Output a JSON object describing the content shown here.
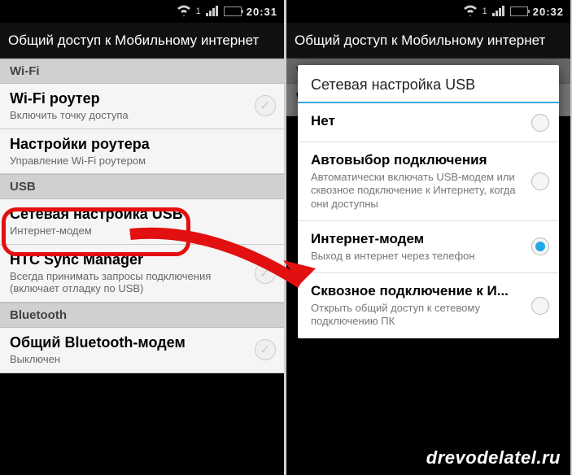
{
  "left": {
    "statusbar": {
      "signal_text": "1",
      "time": "20:31"
    },
    "title": "Общий доступ к Мобильному интернет",
    "sections": {
      "wifi_hdr": "Wi-Fi",
      "usb_hdr": "USB",
      "bt_hdr": "Bluetooth"
    },
    "rows": {
      "wifi_router": {
        "title": "Wi-Fi роутер",
        "sub": "Включить точку доступа"
      },
      "router_cfg": {
        "title": "Настройки роутера",
        "sub": "Управление Wi-Fi роутером"
      },
      "usb_net": {
        "title": "Сетевая настройка USB",
        "sub": "Интернет-модем"
      },
      "htc_sync": {
        "title": "HTC Sync Manager",
        "sub": "Всегда принимать запросы подключения (включает отладку по USB)"
      },
      "bt_modem": {
        "title": "Общий Bluetooth-модем",
        "sub": "Выключен"
      }
    }
  },
  "right": {
    "statusbar": {
      "signal_text": "1",
      "time": "20:32"
    },
    "title": "Общий доступ к Мобильному интернет",
    "row_under": {
      "title": "Wi-Fi роутер"
    },
    "dialog": {
      "title": "Сетевая настройка USB",
      "opts": [
        {
          "title": "Нет",
          "sub": "",
          "selected": false
        },
        {
          "title": "Автовыбор подключения",
          "sub": "Автоматически включать USB-модем или сквозное подключение к Интернету, когда они доступны",
          "selected": false
        },
        {
          "title": "Интернет-модем",
          "sub": "Выход в интернет через телефон",
          "selected": true
        },
        {
          "title": "Сквозное подключение к И...",
          "sub": "Открыть общий доступ к сетевому подключению ПК",
          "selected": false
        }
      ]
    }
  },
  "watermark": "drevodelatel.ru"
}
